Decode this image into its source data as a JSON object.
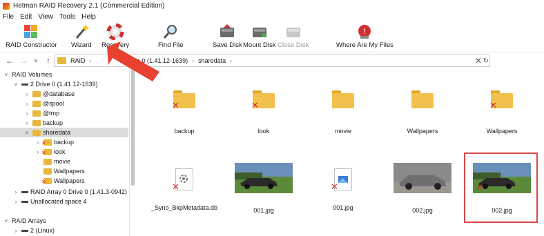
{
  "window": {
    "title": "Hetman RAID Recovery 2.1 (Commercial Edition)"
  },
  "menu": [
    "File",
    "Edit",
    "View",
    "Tools",
    "Help"
  ],
  "toolbar": {
    "raid_constructor": "RAID Constructor",
    "wizard": "Wizard",
    "recovery": "Recovery",
    "find_file": "Find File",
    "save_disk": "Save Disk",
    "mount_disk": "Mount Disk",
    "close_disk": "Close Disk",
    "where_files": "Where Are My Files"
  },
  "address": {
    "segments": [
      "RAID",
      "2 Drive 0 (1.41.12-1639)",
      "sharedata"
    ]
  },
  "tree": {
    "raid_volumes": "RAID Volumes",
    "drive0": "2 Drive 0 (1.41.12-1639)",
    "database": "@database",
    "spool": "@spool",
    "tmp": "@tmp",
    "backup": "backup",
    "sharedata": "sharedata",
    "sub_backup": "backup",
    "sub_look": "look",
    "sub_movie": "movie",
    "sub_wall1": "Wallpapers",
    "sub_wall2": "Wallpapers",
    "raid_array0": "RAID Array 0 Drive 0 (1.41.3-0942)",
    "unallocated": "Unallocated space 4",
    "raid_arrays": "RAID Arrays",
    "linux": "2 (Linux)"
  },
  "files": {
    "f1": "backup",
    "f2": "look",
    "f3": "movie",
    "f4": "Wallpapers",
    "f5": "Wallpapers",
    "f6": "_Syno_BkpMetadata.db",
    "f7": "001.jpg",
    "f8": "001.jpg",
    "f9": "002.jpg",
    "f10": "002.jpg"
  }
}
